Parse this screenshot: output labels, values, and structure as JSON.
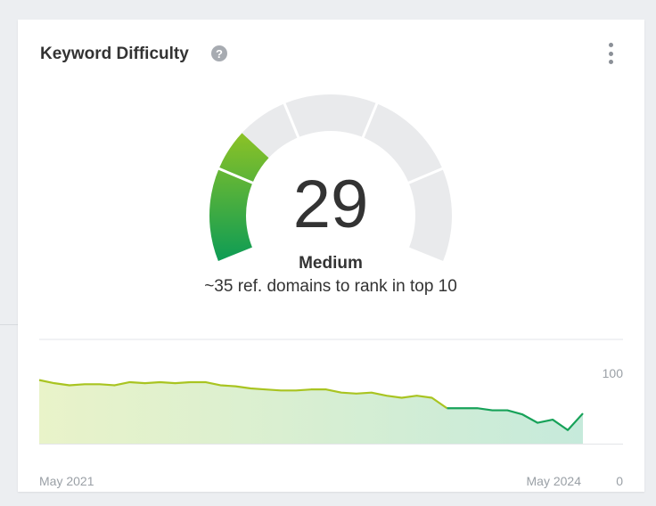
{
  "widget": {
    "title": "Keyword Difficulty",
    "help_glyph": "?",
    "score": "29",
    "level": "Medium",
    "description": "~35 ref. domains to rank in top 10",
    "gauge_segments": 5,
    "gauge_fill_fraction": 0.29
  },
  "colors": {
    "gauge_track": "#e9eaec",
    "green_dark": "#0d9c55",
    "green_light": "#8cc226",
    "line_yellow": "#a9c421",
    "line_green": "#17a259"
  },
  "chart_data": {
    "type": "area",
    "x": [
      "May 2021",
      "",
      "",
      "",
      "",
      "",
      "",
      "",
      "",
      "",
      "",
      "",
      "",
      "",
      "",
      "",
      "",
      "",
      "",
      "",
      "",
      "",
      "",
      "",
      "",
      "",
      "",
      "",
      "",
      "",
      "",
      "",
      "",
      "",
      "",
      "",
      "",
      "",
      "May 2024",
      ""
    ],
    "values": [
      61,
      58,
      56,
      57,
      57,
      56,
      59,
      58,
      59,
      58,
      59,
      59,
      56,
      55,
      53,
      52,
      51,
      51,
      52,
      52,
      49,
      48,
      49,
      46,
      44,
      46,
      44,
      34,
      34,
      34,
      32,
      32,
      28,
      20,
      23,
      13,
      29
    ],
    "x_tick_labels": [
      "May 2021",
      "May 2024"
    ],
    "y_tick_labels": [
      "100",
      "0"
    ],
    "ylim": [
      0,
      100
    ],
    "grid": true
  }
}
